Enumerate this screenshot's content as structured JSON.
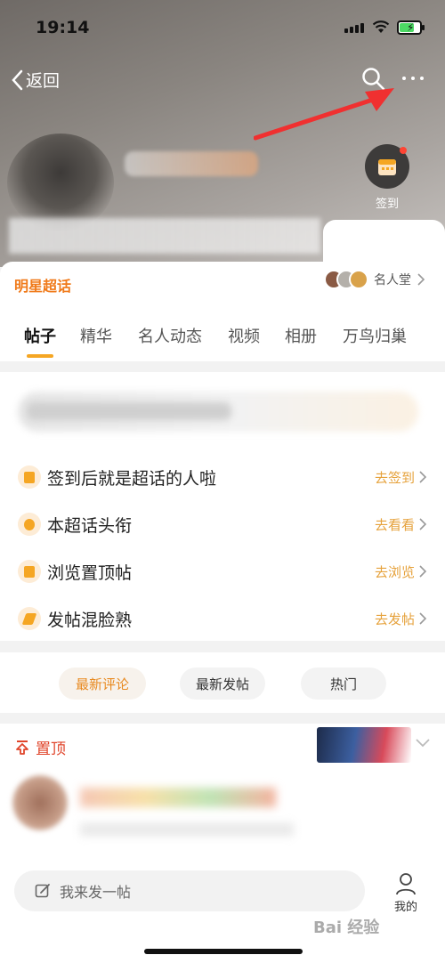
{
  "status_bar": {
    "time": "19:14"
  },
  "nav": {
    "back_label": "返回",
    "checkin_label": "签到"
  },
  "community": {
    "title": "明星超话",
    "hall_label": "名人堂"
  },
  "tabs": [
    {
      "label": "帖子"
    },
    {
      "label": "精华"
    },
    {
      "label": "名人动态"
    },
    {
      "label": "视频"
    },
    {
      "label": "相册"
    },
    {
      "label": "万鸟归巢"
    }
  ],
  "tasks": [
    {
      "label": "签到后就是超话的人啦",
      "action": "去签到",
      "icon": "calendar-icon"
    },
    {
      "label": "本超话头衔",
      "action": "去看看",
      "icon": "medal-icon"
    },
    {
      "label": "浏览置顶帖",
      "action": "去浏览",
      "icon": "document-icon"
    },
    {
      "label": "发帖混脸熟",
      "action": "去发帖",
      "icon": "pen-icon"
    }
  ],
  "sort": {
    "latest_comment": "最新评论",
    "latest_post": "最新发帖",
    "hot": "热门"
  },
  "pinned": {
    "label": "置顶"
  },
  "composer": {
    "placeholder": "我来发一帖"
  },
  "bottom_nav": {
    "me_label": "我的"
  },
  "watermark": "Bai 经验",
  "colors": {
    "accent": "#f5a623",
    "orange_text": "#f07a1a",
    "pinned_red": "#e0452b"
  }
}
